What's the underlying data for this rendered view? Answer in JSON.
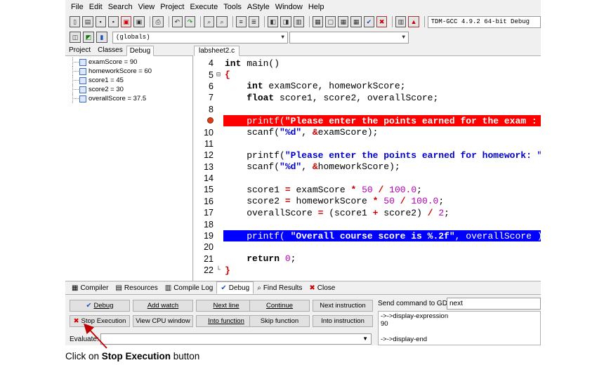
{
  "menu": [
    "File",
    "Edit",
    "Search",
    "View",
    "Project",
    "Execute",
    "Tools",
    "AStyle",
    "Window",
    "Help"
  ],
  "toolbar": {
    "compiler_select": "TDM-GCC 4.9.2 64-bit Debug",
    "scope_select": "(globals)"
  },
  "left_panel": {
    "tabs": [
      "Project",
      "Classes",
      "Debug"
    ],
    "active_tab": "Debug",
    "variables": [
      "examScore = 90",
      "homeworkScore = 60",
      "score1 = 45",
      "score2 = 30",
      "overallScore = 37.5"
    ]
  },
  "editor": {
    "file_tab": "labsheet2.c",
    "lines": [
      {
        "num": "4",
        "fold": "",
        "marker": "",
        "type": "normal",
        "tokens": [
          {
            "t": "kw",
            "v": "int"
          },
          {
            "t": "txt",
            "v": " main()"
          }
        ]
      },
      {
        "num": "5",
        "fold": "⊟",
        "marker": "",
        "type": "normal",
        "tokens": [
          {
            "t": "op",
            "v": "{"
          }
        ]
      },
      {
        "num": "6",
        "fold": "",
        "marker": "",
        "type": "normal",
        "tokens": [
          {
            "t": "txt",
            "v": "    "
          },
          {
            "t": "kw",
            "v": "int"
          },
          {
            "t": "txt",
            "v": " examScore, homeworkScore;"
          }
        ]
      },
      {
        "num": "7",
        "fold": "",
        "marker": "",
        "type": "normal",
        "tokens": [
          {
            "t": "txt",
            "v": "    "
          },
          {
            "t": "kw",
            "v": "float"
          },
          {
            "t": "txt",
            "v": " score1, score2, overallScore;"
          }
        ]
      },
      {
        "num": "8",
        "fold": "",
        "marker": "",
        "type": "normal",
        "tokens": []
      },
      {
        "num": "",
        "fold": "",
        "marker": "breakpoint",
        "type": "bp",
        "tokens": [
          {
            "t": "txt",
            "v": "    printf("
          },
          {
            "t": "str",
            "v": "\"Please enter the points earned for the exam : \""
          },
          {
            "t": "txt",
            "v": ");"
          }
        ]
      },
      {
        "num": "10",
        "fold": "",
        "marker": "",
        "type": "normal",
        "tokens": [
          {
            "t": "txt",
            "v": "    scanf("
          },
          {
            "t": "str",
            "v": "\"%d\""
          },
          {
            "t": "txt",
            "v": ", "
          },
          {
            "t": "op",
            "v": "&"
          },
          {
            "t": "txt",
            "v": "examScore);"
          }
        ]
      },
      {
        "num": "11",
        "fold": "",
        "marker": "",
        "type": "normal",
        "tokens": []
      },
      {
        "num": "12",
        "fold": "",
        "marker": "",
        "type": "normal",
        "tokens": [
          {
            "t": "txt",
            "v": "    printf("
          },
          {
            "t": "str",
            "v": "\"Please enter the points earned for homework: \""
          },
          {
            "t": "txt",
            "v": ");"
          }
        ]
      },
      {
        "num": "13",
        "fold": "",
        "marker": "",
        "type": "normal",
        "tokens": [
          {
            "t": "txt",
            "v": "    scanf("
          },
          {
            "t": "str",
            "v": "\"%d\""
          },
          {
            "t": "txt",
            "v": ", "
          },
          {
            "t": "op",
            "v": "&"
          },
          {
            "t": "txt",
            "v": "homeworkScore);"
          }
        ]
      },
      {
        "num": "14",
        "fold": "",
        "marker": "",
        "type": "normal",
        "tokens": []
      },
      {
        "num": "15",
        "fold": "",
        "marker": "",
        "type": "normal",
        "tokens": [
          {
            "t": "txt",
            "v": "    score1 "
          },
          {
            "t": "op",
            "v": "="
          },
          {
            "t": "txt",
            "v": " examScore "
          },
          {
            "t": "op",
            "v": "*"
          },
          {
            "t": "txt",
            "v": " "
          },
          {
            "t": "num",
            "v": "50"
          },
          {
            "t": "txt",
            "v": " "
          },
          {
            "t": "op",
            "v": "/"
          },
          {
            "t": "txt",
            "v": " "
          },
          {
            "t": "num",
            "v": "100.0"
          },
          {
            "t": "txt",
            "v": ";"
          }
        ]
      },
      {
        "num": "16",
        "fold": "",
        "marker": "",
        "type": "normal",
        "tokens": [
          {
            "t": "txt",
            "v": "    score2 "
          },
          {
            "t": "op",
            "v": "="
          },
          {
            "t": "txt",
            "v": " homeworkScore "
          },
          {
            "t": "op",
            "v": "*"
          },
          {
            "t": "txt",
            "v": " "
          },
          {
            "t": "num",
            "v": "50"
          },
          {
            "t": "txt",
            "v": " "
          },
          {
            "t": "op",
            "v": "/"
          },
          {
            "t": "txt",
            "v": " "
          },
          {
            "t": "num",
            "v": "100.0"
          },
          {
            "t": "txt",
            "v": ";"
          }
        ]
      },
      {
        "num": "17",
        "fold": "",
        "marker": "",
        "type": "normal",
        "tokens": [
          {
            "t": "txt",
            "v": "    overallScore "
          },
          {
            "t": "op",
            "v": "="
          },
          {
            "t": "txt",
            "v": " (score1 "
          },
          {
            "t": "op",
            "v": "+"
          },
          {
            "t": "txt",
            "v": " score2) "
          },
          {
            "t": "op",
            "v": "/"
          },
          {
            "t": "txt",
            "v": " "
          },
          {
            "t": "num",
            "v": "2"
          },
          {
            "t": "txt",
            "v": ";"
          }
        ]
      },
      {
        "num": "18",
        "fold": "",
        "marker": "",
        "type": "normal",
        "tokens": []
      },
      {
        "num": "19",
        "fold": "",
        "marker": "",
        "type": "cur",
        "tokens": [
          {
            "t": "txt",
            "v": "    printf( "
          },
          {
            "t": "str",
            "v": "\"Overall course score is %.2f\""
          },
          {
            "t": "txt",
            "v": ", overallScore );"
          }
        ]
      },
      {
        "num": "20",
        "fold": "",
        "marker": "",
        "type": "normal",
        "tokens": []
      },
      {
        "num": "21",
        "fold": "",
        "marker": "",
        "type": "normal",
        "tokens": [
          {
            "t": "txt",
            "v": "    "
          },
          {
            "t": "kw",
            "v": "return"
          },
          {
            "t": "txt",
            "v": " "
          },
          {
            "t": "num",
            "v": "0"
          },
          {
            "t": "txt",
            "v": ";"
          }
        ]
      },
      {
        "num": "22",
        "fold": "└",
        "marker": "",
        "type": "normal",
        "tokens": [
          {
            "t": "op",
            "v": "}"
          }
        ]
      }
    ]
  },
  "bottom_tabs": [
    {
      "label": "Compiler",
      "icon": "grid-icon",
      "glyph": "▦"
    },
    {
      "label": "Resources",
      "icon": "resources-icon",
      "glyph": "▤"
    },
    {
      "label": "Compile Log",
      "icon": "bar-chart-icon",
      "glyph": "▥"
    },
    {
      "label": "Debug",
      "icon": "checkmark-icon",
      "glyph": "✔"
    },
    {
      "label": "Find Results",
      "icon": "find-icon",
      "glyph": "⌕"
    },
    {
      "label": "Close",
      "icon": "close-icon",
      "glyph": "✖"
    }
  ],
  "active_bottom_tab": "Debug",
  "debug_buttons": {
    "debug": "Debug",
    "add_watch": "Add watch",
    "next_line": "Next line",
    "continue": "Continue",
    "next_instruction": "Next instruction",
    "stop_execution": "Stop Execution",
    "view_cpu_window": "View CPU window",
    "into_function": "Into function",
    "skip_function": "Skip function",
    "into_instruction": "Into instruction"
  },
  "evaluate_label": "Evaluate:",
  "gdb": {
    "label": "Send command to GDB:",
    "value": "next",
    "output": [
      "->->display-expression",
      "90",
      "",
      "->->display-end"
    ]
  },
  "callout": {
    "prefix": "Click on ",
    "bold": "Stop Execution",
    "suffix": " button"
  },
  "colors": {
    "breakpoint_line": "#ff0000",
    "current_line": "#0000ff",
    "string": "#0000cc",
    "number": "#b400b4",
    "arrow": "#c00000"
  }
}
